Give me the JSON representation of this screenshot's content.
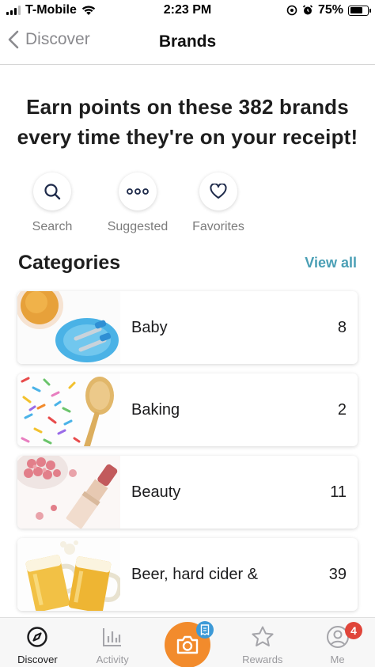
{
  "status_bar": {
    "carrier": "T-Mobile",
    "time": "2:23 PM",
    "battery": "75%",
    "battery_level": 0.75
  },
  "nav": {
    "back_label": "Discover",
    "title": "Brands"
  },
  "headline": "Earn points on these 382 brands every time they're on your receipt!",
  "quick_actions": [
    {
      "label": "Search",
      "icon": "search-icon"
    },
    {
      "label": "Suggested",
      "icon": "more-dots-icon"
    },
    {
      "label": "Favorites",
      "icon": "heart-icon"
    }
  ],
  "categories": {
    "title": "Categories",
    "view_all": "View all",
    "items": [
      {
        "name": "Baby",
        "count": "8",
        "icon": "baby-food-image"
      },
      {
        "name": "Baking",
        "count": "2",
        "icon": "sprinkles-spoon-image"
      },
      {
        "name": "Beauty",
        "count": "11",
        "icon": "lipstick-blush-image"
      },
      {
        "name": "Beer, hard cider &",
        "count": "39",
        "icon": "beer-mugs-image"
      }
    ]
  },
  "tab_bar": {
    "tabs": [
      {
        "label": "Discover",
        "icon": "compass-icon",
        "active": true
      },
      {
        "label": "Activity",
        "icon": "bar-chart-icon",
        "active": false
      },
      {
        "label": "",
        "icon": "camera-icon",
        "active": false
      },
      {
        "label": "Rewards",
        "icon": "star-icon",
        "active": false
      },
      {
        "label": "Me",
        "icon": "profile-icon",
        "active": false
      }
    ],
    "me_badge": "4",
    "accent_color": "#f28b2c"
  },
  "colors": {
    "link": "#4a9fb5",
    "badge_red": "#e0453a",
    "badge_blue": "#3d9ad7"
  }
}
